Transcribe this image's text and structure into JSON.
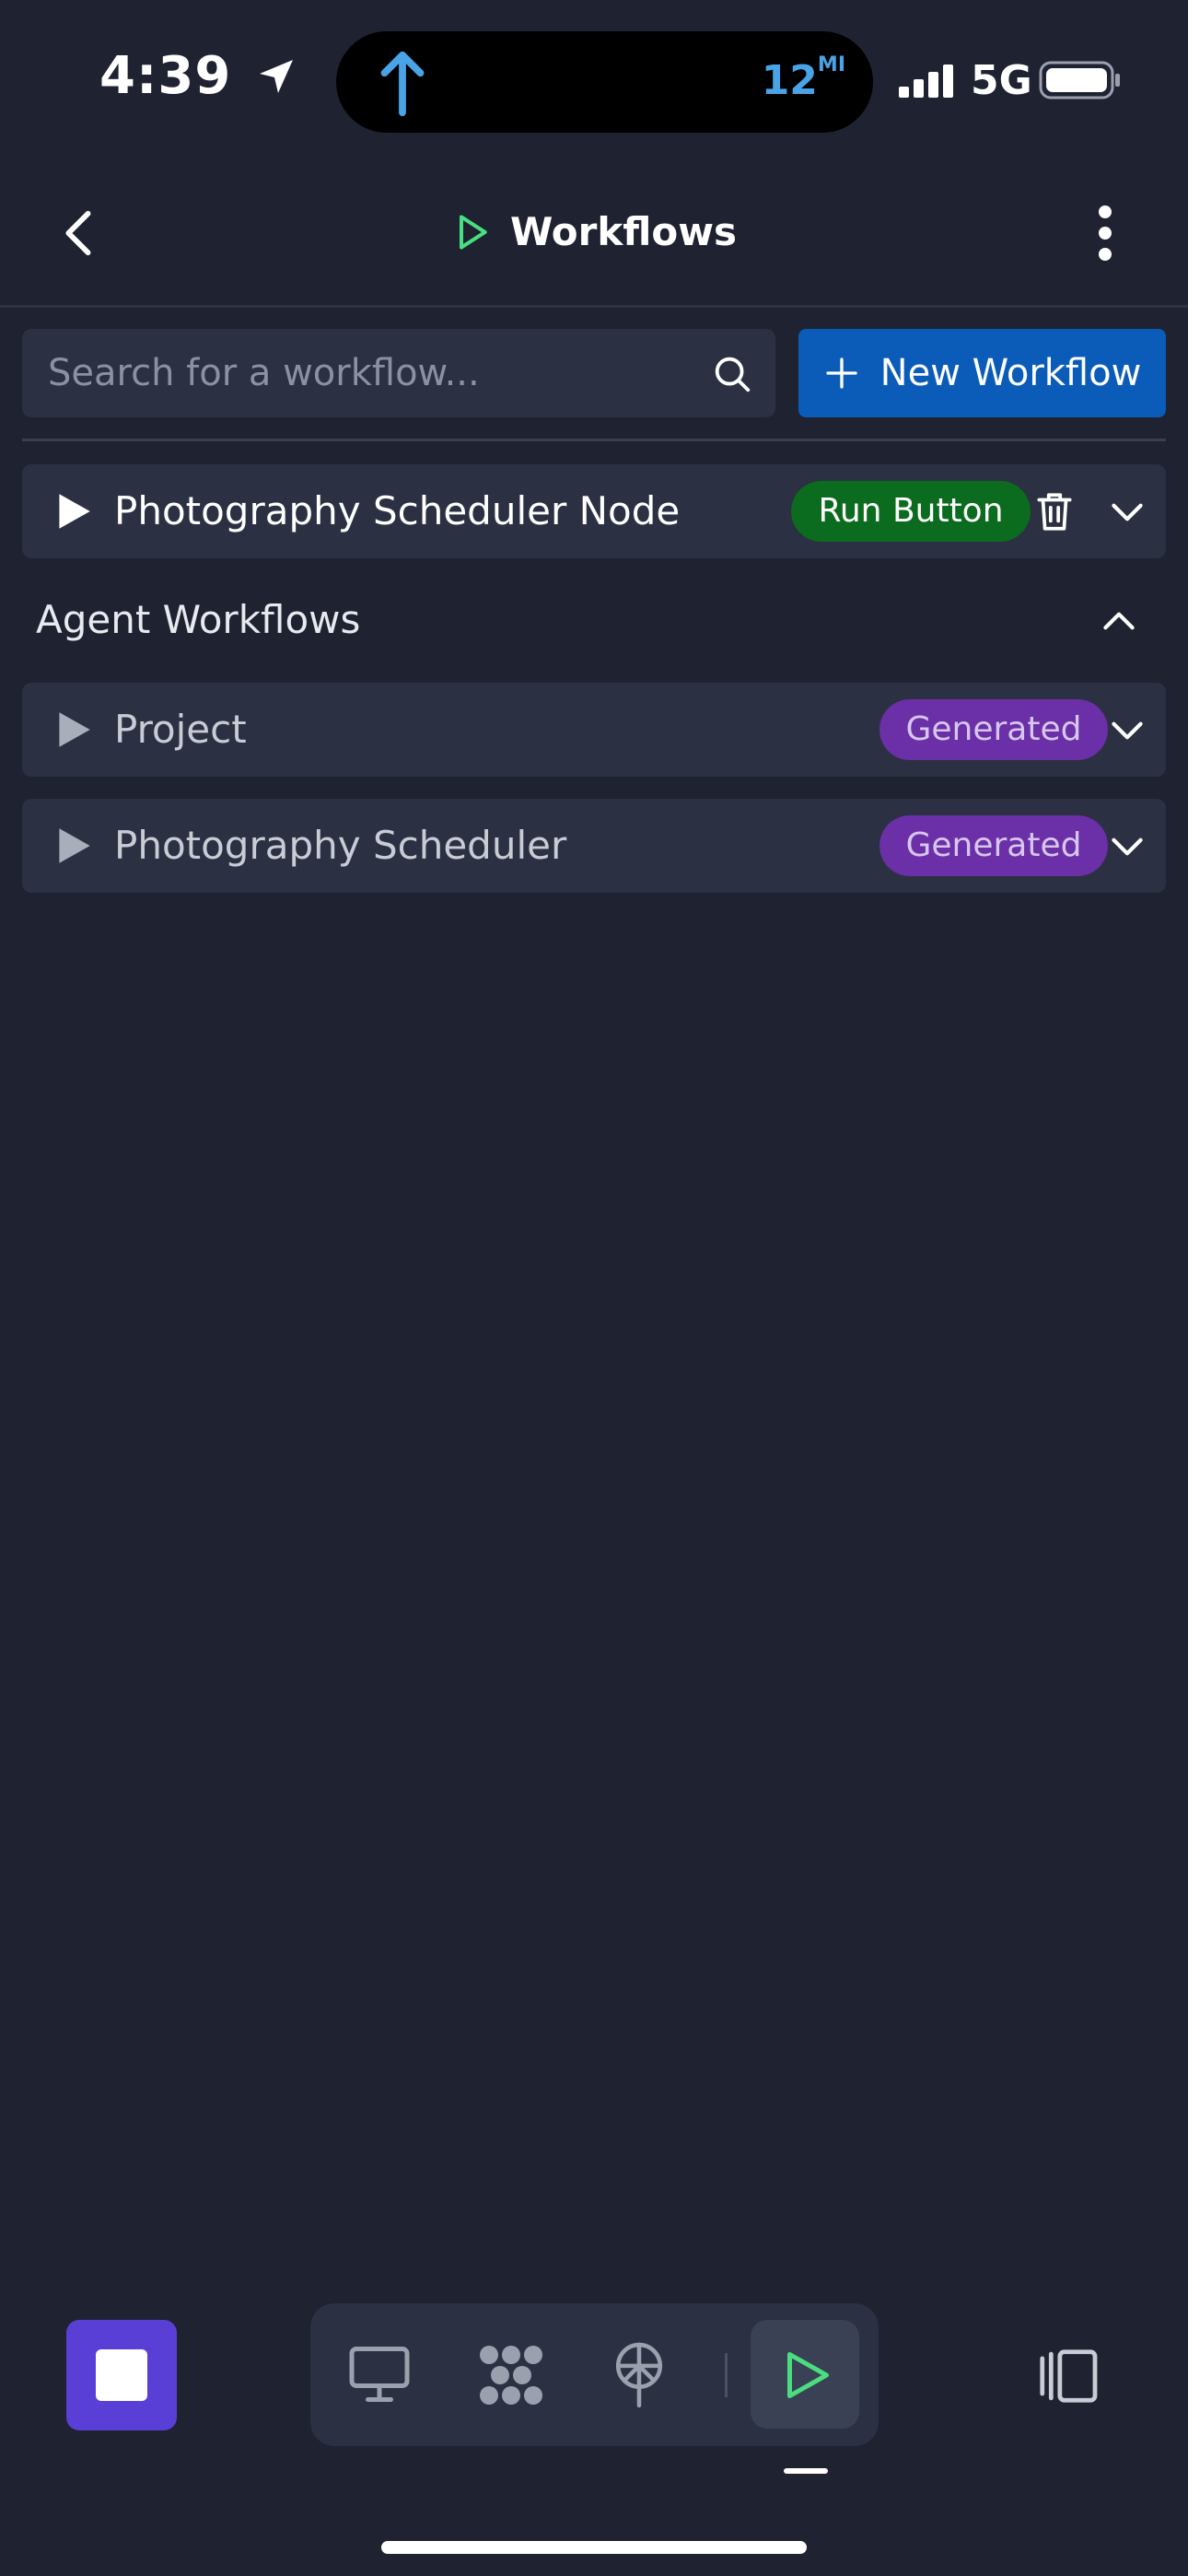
{
  "status_bar": {
    "time": "4:39",
    "nav_distance": "12",
    "nav_distance_unit": "MI",
    "network": "5G",
    "icons": [
      "location-arrow-icon",
      "up-arrow-icon",
      "signal-icon",
      "battery-icon"
    ]
  },
  "header": {
    "title": "Workflows",
    "icons": [
      "back-chevron-icon",
      "play-outline-icon",
      "more-vertical-icon"
    ],
    "accent_color": "#4ade80"
  },
  "search": {
    "placeholder": "Search for a workflow...",
    "value": ""
  },
  "new_workflow": {
    "label": "New Workflow",
    "color": "#0b5cb8"
  },
  "pinned_workflow": {
    "name": "Photography Scheduler Node",
    "badge": "Run Button",
    "badge_color": "#0b6b1e"
  },
  "agent_section": {
    "title": "Agent Workflows",
    "items": [
      {
        "name": "Project",
        "badge": "Generated"
      },
      {
        "name": "Photography Scheduler",
        "badge": "Generated"
      }
    ],
    "badge_color": "#6b2fa8"
  },
  "bottom_bar": {
    "stop_color": "#5a3fd6",
    "dock_icons": [
      "monitor-icon",
      "hexagon-grid-icon",
      "antenna-icon",
      "play-icon"
    ],
    "active": "play-icon",
    "right_icon": "panel-switch-icon"
  }
}
